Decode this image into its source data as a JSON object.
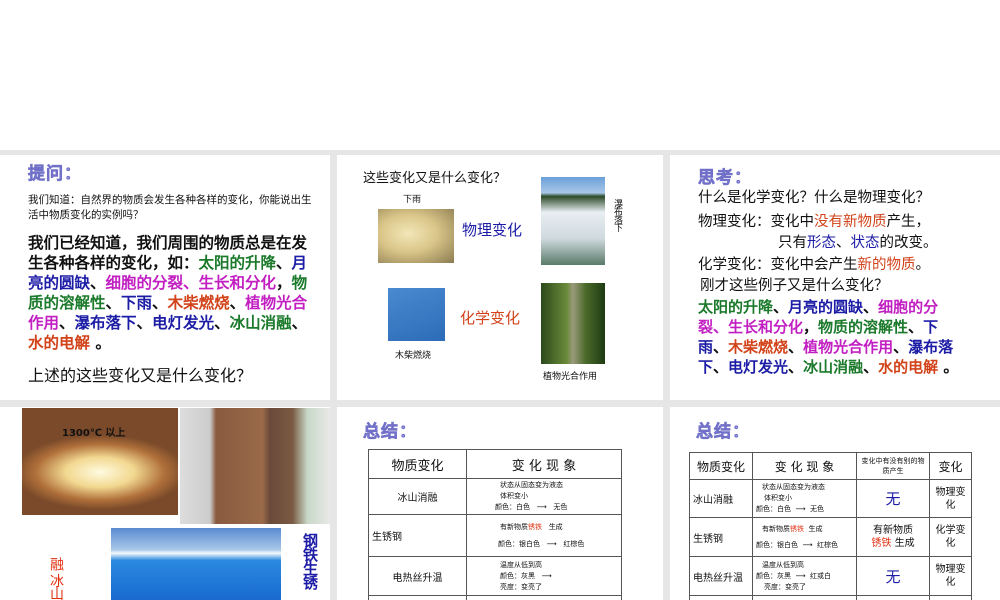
{
  "colors": {
    "green": "#1b7a2b",
    "blue": "#1c1ca6",
    "magenta": "#c21fc2",
    "orange": "#d2431a",
    "black": "#111111"
  },
  "slide1": {
    "title": "提问：",
    "intro": "我们知道：自然界的物质会发生各种各样的变化，你能说出生活中物质变化的实例吗？",
    "body": [
      [
        "black",
        "我们已经知道，我们周围的物质总是在发生各种各样的变化，如："
      ],
      [
        "green",
        "太阳的升降"
      ],
      [
        "black",
        "、"
      ],
      [
        "blue",
        "月亮的圆缺"
      ],
      [
        "black",
        "、"
      ],
      [
        "magenta",
        "细胞的分裂、生长和分化"
      ],
      [
        "black",
        "，"
      ],
      [
        "green",
        "物质的溶解性"
      ],
      [
        "black",
        "、"
      ],
      [
        "blue",
        "下雨"
      ],
      [
        "black",
        "、"
      ],
      [
        "orange",
        "木柴燃烧"
      ],
      [
        "black",
        "、"
      ],
      [
        "magenta",
        "植物光合作用"
      ],
      [
        "black",
        "、"
      ],
      [
        "blue",
        "瀑布落下"
      ],
      [
        "black",
        "、"
      ],
      [
        "blue",
        "电灯发光"
      ],
      [
        "black",
        "、"
      ],
      [
        "green",
        "冰山消融"
      ],
      [
        "black",
        "、"
      ],
      [
        "orange",
        "水的电解"
      ],
      [
        "black",
        " 。"
      ]
    ],
    "question": "上述的这些变化又是什么变化？"
  },
  "slide2": {
    "title": "这些变化又是什么变化？",
    "rain": "下雨",
    "physical": "物理变化",
    "waterfall": "瀑布落下",
    "chemical": "化学变化",
    "burning": "木柴燃烧",
    "photosynthesis": "植物光合作用"
  },
  "slide3": {
    "title": "思考：",
    "q1": "什么是化学变化？什么是物理变化？",
    "phys": [
      [
        "black",
        "物理变化：变化中"
      ],
      [
        "orange",
        "没有新物质"
      ],
      [
        "black",
        "产生，"
      ]
    ],
    "phys2": [
      [
        "black",
        "只有"
      ],
      [
        "blue",
        "形态"
      ],
      [
        "black",
        "、"
      ],
      [
        "blue",
        "状态"
      ],
      [
        "black",
        "的改变。"
      ]
    ],
    "chem": [
      [
        "black",
        "化学变化：变化中会产生"
      ],
      [
        "orange",
        "新的物质"
      ],
      [
        "black",
        "。"
      ]
    ],
    "q2": "刚才这些例子又是什么变化？",
    "body": [
      [
        "green",
        "太阳的升降"
      ],
      [
        "black",
        "、"
      ],
      [
        "blue",
        "月亮的圆缺"
      ],
      [
        "black",
        "、"
      ],
      [
        "magenta",
        "细胞的分裂、生长和分化"
      ],
      [
        "black",
        "，"
      ],
      [
        "green",
        "物质的溶解性"
      ],
      [
        "black",
        "、"
      ],
      [
        "blue",
        "下雨"
      ],
      [
        "black",
        "、"
      ],
      [
        "orange",
        "木柴燃烧"
      ],
      [
        "black",
        "、"
      ],
      [
        "magenta",
        "植物光合作用"
      ],
      [
        "black",
        "、"
      ],
      [
        "blue",
        "瀑布落下"
      ],
      [
        "black",
        "、"
      ],
      [
        "blue",
        "电灯发光"
      ],
      [
        "black",
        "、"
      ],
      [
        "green",
        "冰山消融"
      ],
      [
        "black",
        "、"
      ],
      [
        "orange",
        "水的电解"
      ],
      [
        "black",
        " 。"
      ]
    ]
  },
  "slide4": {
    "temp": "1300℃ 以上",
    "ice_label": "融 冰山消",
    "rust_label": "钢铁生锈"
  },
  "slide5": {
    "title": "总结：",
    "headers": [
      "物质变化",
      "变 化 现 象"
    ],
    "rows": [
      {
        "name": "冰山消融",
        "l1": "状态从固态变为液态",
        "l2": "体积变小",
        "l3a": "颜色：白色",
        "l3b": "无色"
      },
      {
        "name": "生锈钢",
        "l1a": "有新物质",
        "l1r": "锈铁",
        "l1b": "生成",
        "l3a": "颜色：银白色",
        "l3b": "红棕色"
      },
      {
        "name": "电热丝升温",
        "l1": "温度从低到高",
        "l3a": "颜色：灰黑",
        "l4": "亮度：变亮了"
      }
    ]
  },
  "slide6": {
    "title": "总结：",
    "headers": [
      "物质变化",
      "变 化 现 象",
      "变化中有没有别的物质产生",
      "变化"
    ],
    "rows": [
      {
        "name": "冰山消融",
        "l1": "状态从固态变为液态",
        "l2": "体积变小",
        "l3a": "颜色：白色",
        "l3b": "无色",
        "new": "无",
        "type": "物理变化"
      },
      {
        "name": "生锈钢",
        "l1a": "有新物质",
        "l1r": "锈铁",
        "l1b": "生成",
        "l3a": "颜色：银白色",
        "l3b": "红棕色",
        "new_a": "有新物质",
        "new_r": "锈铁",
        "new_b": "生成",
        "type": "化学变化"
      },
      {
        "name": "电热丝升温",
        "l1": "温度从低到高",
        "l3a": "颜色：灰黑",
        "l3b": "红或白",
        "l4": "亮度：变亮了",
        "new": "无",
        "type": "物理变化"
      }
    ]
  }
}
